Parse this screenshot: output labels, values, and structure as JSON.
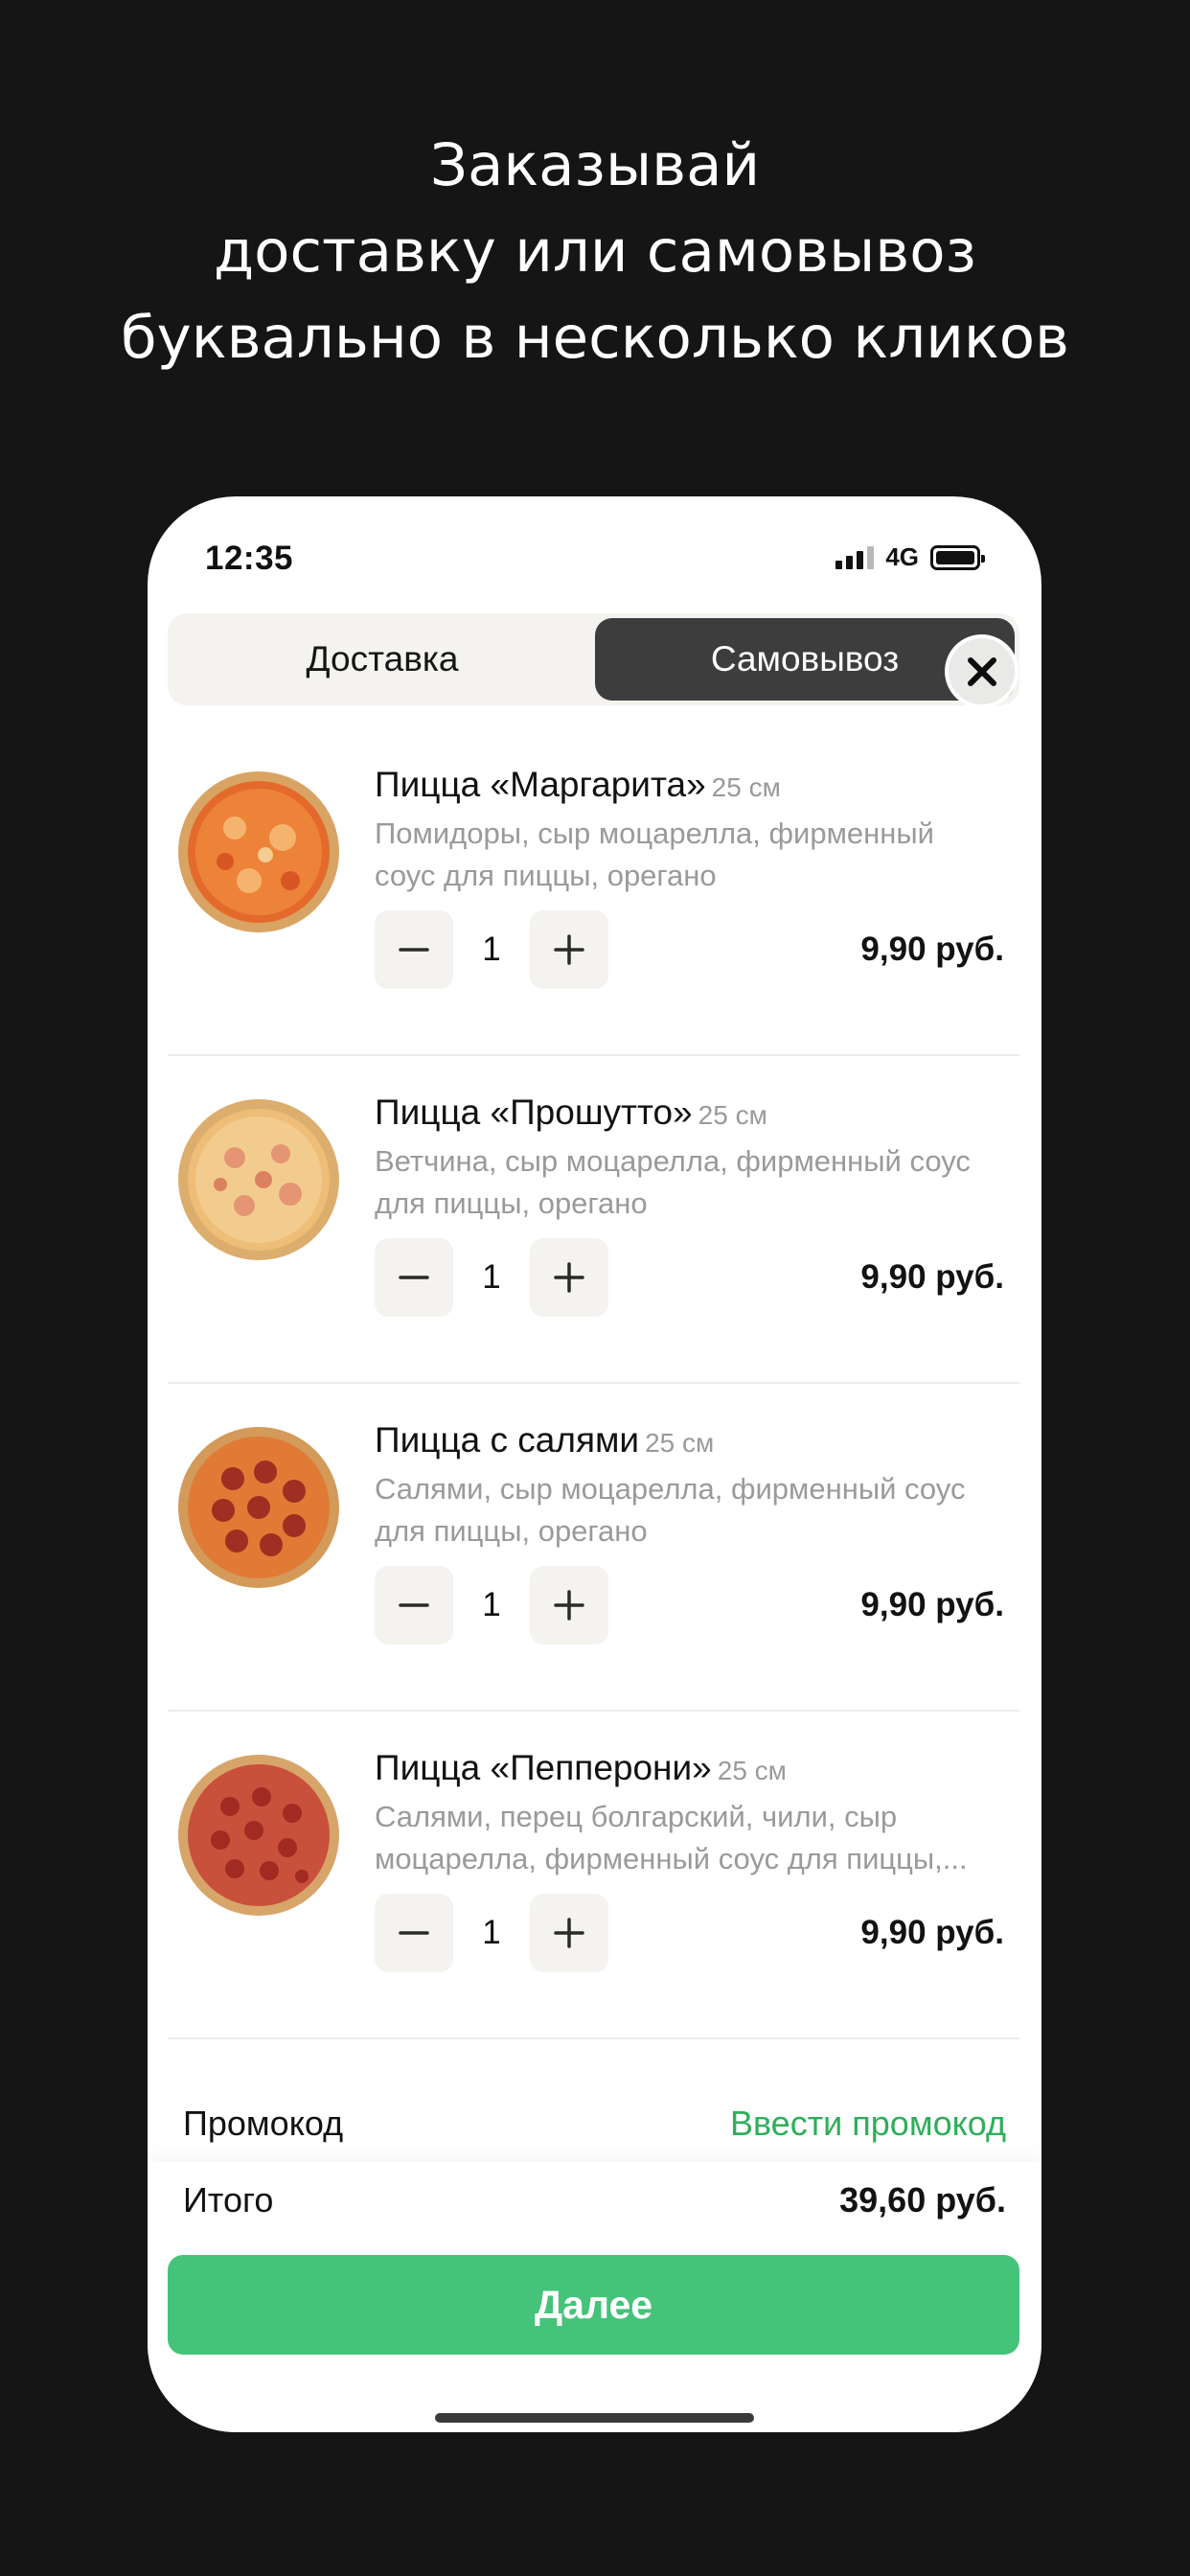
{
  "headline": {
    "line1": "Заказывай",
    "line2": "доставку или самовывоз",
    "line3": "буквально в несколько кликов"
  },
  "status_bar": {
    "time": "12:35",
    "network": "4G",
    "icons": [
      "signal-icon",
      "battery-icon"
    ]
  },
  "order_type": {
    "tabs": [
      {
        "label": "Доставка",
        "selected": false
      },
      {
        "label": "Самовывоз",
        "selected": true
      }
    ],
    "close_icon": "close-icon"
  },
  "cart": {
    "items": [
      {
        "title": "Пицца «Маргарита»",
        "size": "25 см",
        "description": "Помидоры, сыр моцарелла, фирменный соус для пиццы, орегано",
        "quantity": "1",
        "price": "9,90 руб.",
        "image": "pizza-margherita-photo"
      },
      {
        "title": "Пицца «Прошутто»",
        "size": "25 см",
        "description": "Ветчина, сыр моцарелла, фирменный соус для пиццы, орегано",
        "quantity": "1",
        "price": "9,90 руб.",
        "image": "pizza-prosciutto-photo"
      },
      {
        "title": "Пицца с салями",
        "size": "25 см",
        "description": "Салями, сыр моцарелла, фирменный соус для пиццы, орегано",
        "quantity": "1",
        "price": "9,90 руб.",
        "image": "pizza-salami-photo"
      },
      {
        "title": "Пицца «Пепперони»",
        "size": "25 см",
        "description": "Салями, перец болгарский, чили, сыр моцарелла, фирменный соус для пиццы,...",
        "quantity": "1",
        "price": "9,90 руб.",
        "image": "pizza-pepperoni-photo"
      }
    ],
    "stepper_icons": [
      "minus-icon",
      "plus-icon"
    ]
  },
  "promo": {
    "label": "Промокод",
    "link": "Ввести промокод"
  },
  "summary": {
    "total_label": "Итого",
    "total_value": "39,60 руб.",
    "next_button": "Далее"
  },
  "colors": {
    "background": "#151515",
    "accent_green": "#45c37a",
    "promo_green": "#2fae5a",
    "selected_tab": "#3d3d3d",
    "control_bg": "#f4f3ef"
  }
}
